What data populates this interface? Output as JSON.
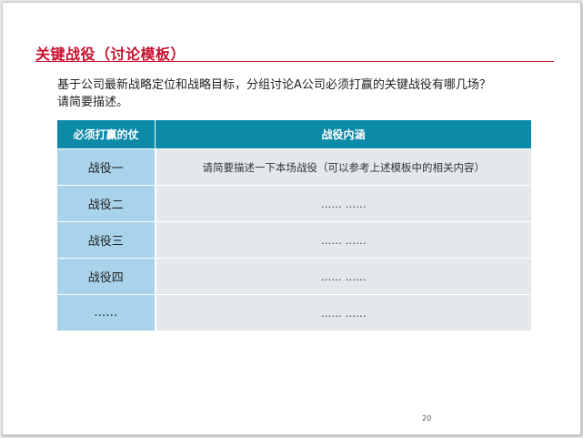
{
  "slide": {
    "title": "关键战役（讨论模板）",
    "intro_lines": [
      "基于公司最新战略定位和战略目标，分组讨论A公司必须打赢的关键战役有哪几场？",
      "请简要描述。"
    ],
    "table": {
      "headers": [
        "必须打赢的仗",
        "战役内涵"
      ],
      "rows": [
        {
          "name": "战役一",
          "content": "请简要描述一下本场战役（可以参考上述模板中的相关内容）"
        },
        {
          "name": "战役二",
          "content": "……  ……"
        },
        {
          "name": "战役三",
          "content": "……  ……"
        },
        {
          "name": "战役四",
          "content": "……  ……"
        },
        {
          "name": "……",
          "content": "……  ……"
        }
      ]
    },
    "page_number": "20"
  },
  "colors": {
    "title_red": "#c8102e",
    "header_teal": "#0c8aa8",
    "name_cell_blue": "#a9d3ea",
    "content_cell_gray": "#e4e8ec"
  }
}
